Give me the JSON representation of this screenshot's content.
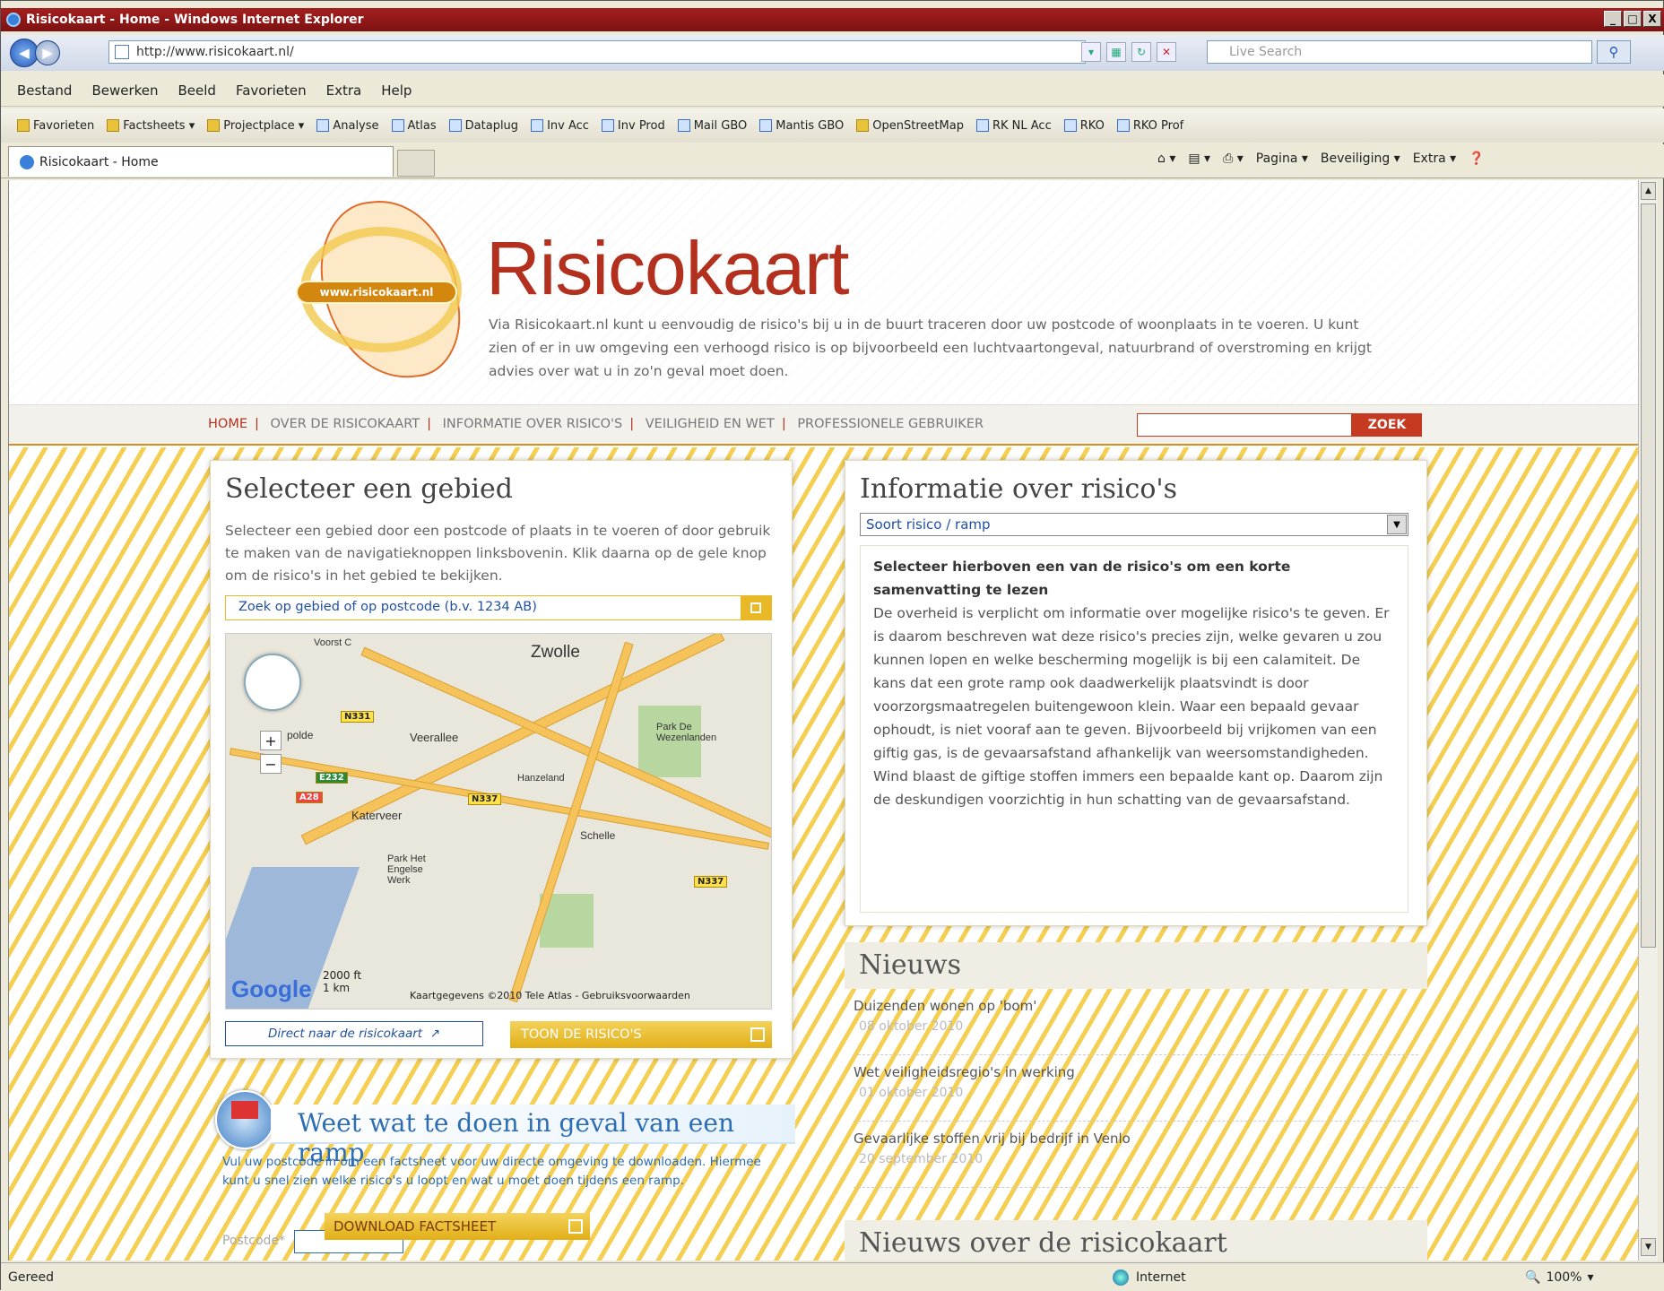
{
  "window": {
    "title": "Risicokaart - Home - Windows Internet Explorer",
    "controls": [
      "_",
      "□",
      "X"
    ]
  },
  "address": {
    "url": "http://www.risicokaart.nl/",
    "search_placeholder": "Live Search"
  },
  "menu": [
    "Bestand",
    "Bewerken",
    "Beeld",
    "Favorieten",
    "Extra",
    "Help"
  ],
  "favorites": [
    "Favorieten",
    "Factsheets ▾",
    "Projectplace ▾",
    "Analyse",
    "Atlas",
    "Dataplug",
    "Inv Acc",
    "Inv Prod",
    "Mail GBO",
    "Mantis GBO",
    "OpenStreetMap",
    "RK NL Acc",
    "RKO",
    "RKO Prof"
  ],
  "tab": {
    "label": "Risicokaart - Home"
  },
  "commandbar": [
    "Pagina ▾",
    "Beveiliging ▾",
    "Extra ▾"
  ],
  "site": {
    "brand": "Risicokaart",
    "logo_text": "www.risicokaart.nl",
    "intro": "Via Risicokaart.nl kunt u eenvoudig de risico's bij u in de buurt traceren door uw postcode of woonplaats in te voeren. U kunt zien of er in uw omgeving een verhoogd risico is op bijvoorbeeld een luchtvaartongeval, natuurbrand of overstroming en krijgt advies over wat u in zo'n geval moet doen.",
    "nav": [
      "HOME",
      "OVER DE RISICOKAART",
      "INFORMATIE OVER RISICO'S",
      "VEILIGHEID EN WET",
      "PROFESSIONELE GEBRUIKER"
    ],
    "search_button": "ZOEK"
  },
  "select_panel": {
    "title": "Selecteer een gebied",
    "text": "Selecteer een gebied door een postcode of plaats in te voeren of door gebruik te maken van de navigatieknoppen linksbovenin. Klik daarna op de gele knop om de risico's in het gebied te bekijken.",
    "search_placeholder": "Zoek op gebied of op postcode (b.v. 1234 AB)",
    "map_labels": [
      "Zwolle",
      "Voorst C",
      "Veerallee",
      "Hanzeland",
      "Katerveer",
      "Schelle",
      "Park Het Engelse Werk",
      "Park De Wezenlanden",
      "polde"
    ],
    "shields": [
      "N331",
      "N337",
      "N337",
      "A28",
      "E232"
    ],
    "scale_ft": "2000 ft",
    "scale_km": "1 km",
    "attribution": "Kaartgegevens ©2010 Tele Atlas - Gebruiksvoorwaarden",
    "google": "Google",
    "direct_link": "Direct naar de risicokaart",
    "toon_button": "TOON DE RISICO'S"
  },
  "info_panel": {
    "title": "Informatie over risico's",
    "select_value": "Soort risico / ramp",
    "heading": "Selecteer hierboven een van de risico's om een korte samenvatting te lezen",
    "body": "De overheid is verplicht om informatie over mogelijke risico's te geven. Er is daarom beschreven wat deze risico's precies zijn, welke gevaren u zou kunnen lopen en welke bescherming mogelijk is bij een calamiteit. De kans dat een grote ramp ook daadwerkelijk plaatsvindt is door voorzorgsmaatregelen buitengewoon klein. Waar een bepaald gevaar ophoudt, is niet vooraf aan te geven. Bijvoorbeeld bij vrijkomen van een giftig gas, is de gevaarsafstand afhankelijk van weersomstandigheden. Wind blaast de giftige stoffen immers een bepaalde kant op. Daarom zijn de deskundigen voorzichtig in hun schatting van de gevaarsafstand."
  },
  "news": {
    "title": "Nieuws",
    "items": [
      {
        "title": "Duizenden wonen op 'bom'",
        "date": "08 oktober 2010"
      },
      {
        "title": "Wet veiligheidsregio's in werking",
        "date": "01 oktober 2010"
      },
      {
        "title": "Gevaarlijke stoffen vrij bij bedrijf in Venlo",
        "date": "20 september 2010"
      }
    ],
    "title2": "Nieuws over de risicokaart"
  },
  "weet": {
    "title": "Weet wat te doen in geval van een ramp",
    "text": "Vul uw postcode in om een factsheet voor uw directe omgeving te downloaden. Hiermee kunt u snel zien welke risico's u loopt en wat u moet doen tijdens een ramp.",
    "postcode_label": "Postcode*",
    "download_button": "DOWNLOAD FACTSHEET"
  },
  "status": {
    "left": "Gereed",
    "zone": "Internet",
    "zoom": "100%"
  }
}
